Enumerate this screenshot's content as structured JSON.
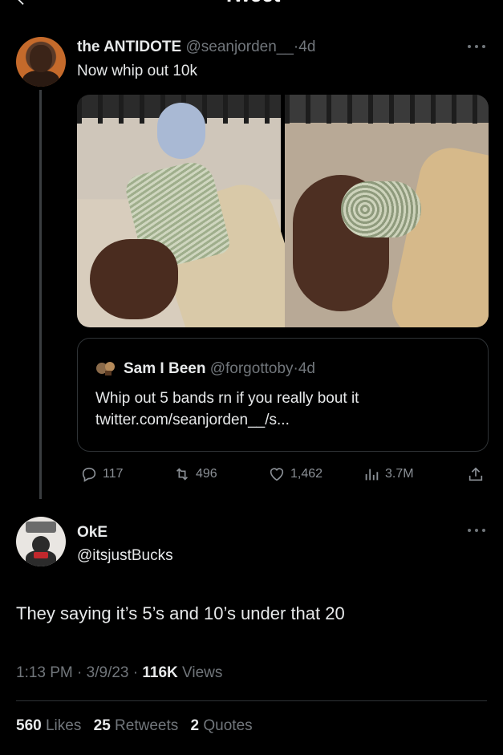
{
  "header": {
    "title": "Tweet"
  },
  "original_tweet": {
    "display_name": "the ANTIDOTE",
    "handle": "@seanjorden__",
    "separator": "·",
    "age": "4d",
    "text": "Now whip out 10k"
  },
  "quoted_tweet": {
    "display_name": "Sam I Been",
    "handle": "@forgottoby",
    "separator": "·",
    "age": "4d",
    "text": "Whip out 5 bands rn if you really bout it twitter.com/seanjorden__/s..."
  },
  "actions": {
    "replies": "117",
    "retweets": "496",
    "likes": "1,462",
    "views": "3.7M"
  },
  "reply_tweet": {
    "display_name": "OkE",
    "handle": "@itsjustBucks",
    "text": "They saying it’s 5’s and 10’s under that 20",
    "time": "1:13 PM",
    "date": "3/9/23",
    "views_count": "116K",
    "views_label": "Views"
  },
  "stats": {
    "likes_count": "560",
    "likes_label": "Likes",
    "retweets_count": "25",
    "retweets_label": "Retweets",
    "quotes_count": "2",
    "quotes_label": "Quotes"
  },
  "colors": {
    "background": "#000000",
    "text": "#e7e9ea",
    "muted": "#71767b",
    "border": "#2f3336"
  },
  "icons": [
    "back-arrow-icon",
    "more-icon",
    "reply-icon",
    "retweet-icon",
    "like-icon",
    "views-icon",
    "share-icon"
  ]
}
